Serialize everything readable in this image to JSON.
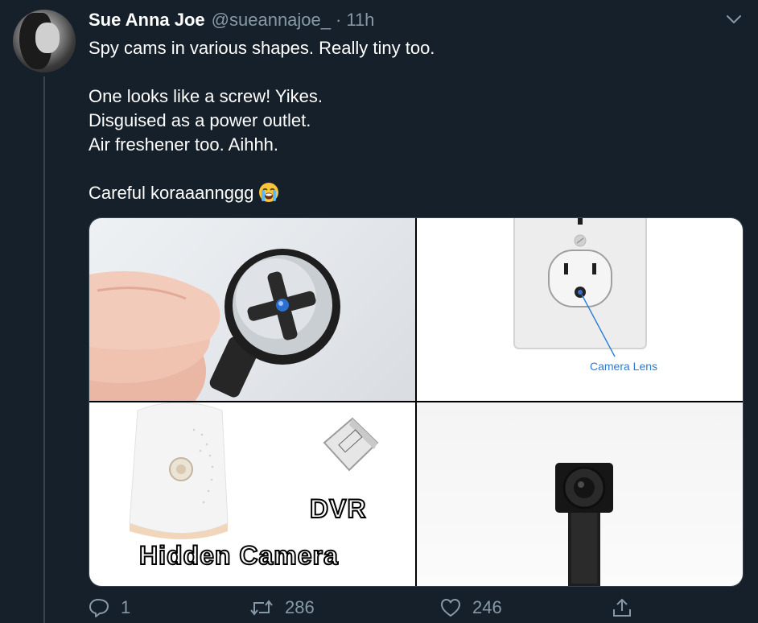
{
  "tweet": {
    "author_name": "Sue Anna Joe",
    "author_handle": "@sueannajoe_",
    "separator": "·",
    "time": "11h",
    "lines": [
      "Spy cams in various shapes. Really tiny too.",
      "One looks like a screw! Yikes.",
      "Disguised as a power outlet.",
      "Air freshener too. Aihhh.",
      "Careful koraaannggg"
    ],
    "emoji": "loudly-crying-face-emoji"
  },
  "media": {
    "image_count": 4,
    "labels": {
      "camera_lens": "Camera Lens",
      "dvr": "DVR",
      "hidden_camera": "Hidden Camera"
    }
  },
  "actions": {
    "reply_count": "1",
    "retweet_count": "286",
    "like_count": "246"
  },
  "colors": {
    "background": "#15202b",
    "secondary_text": "#8899a6",
    "border": "#38444d",
    "link_blue": "#2b7bd6"
  },
  "icons": [
    "chevron-down-icon",
    "reply-icon",
    "retweet-icon",
    "like-icon",
    "share-icon"
  ]
}
